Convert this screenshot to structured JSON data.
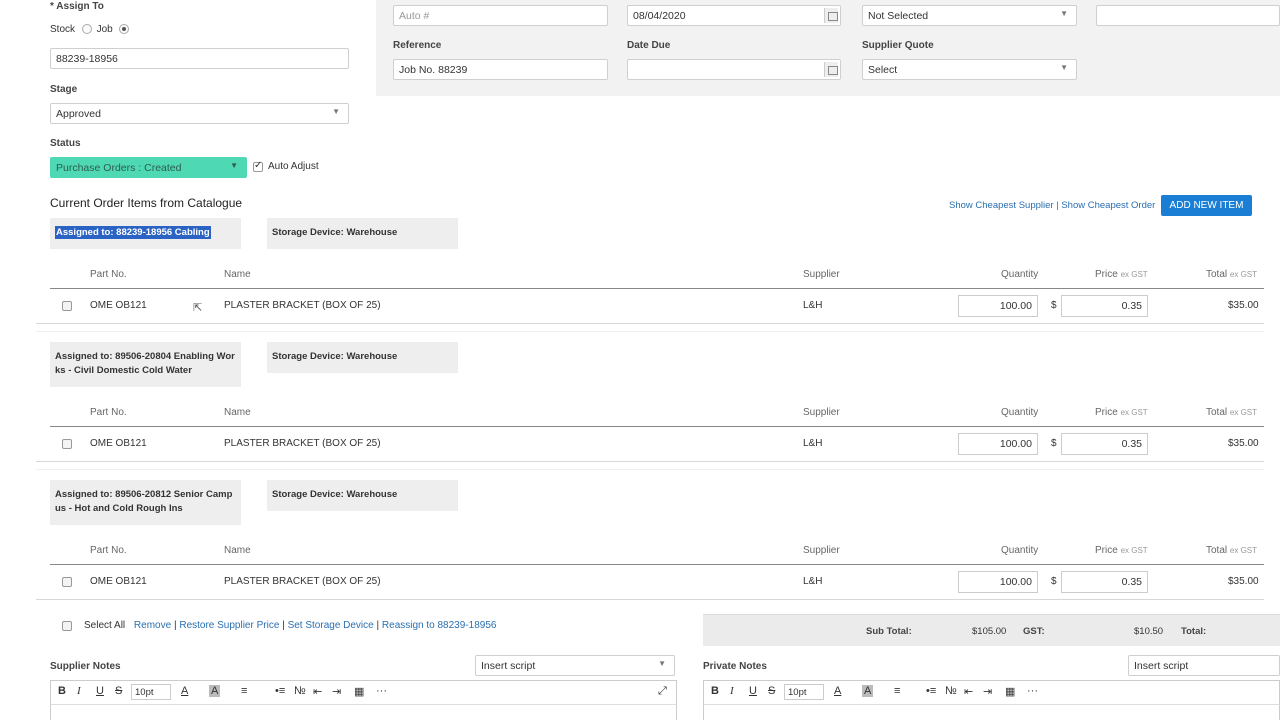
{
  "assign": {
    "label": "* Assign To",
    "opt_stock": "Stock",
    "opt_job": "Job",
    "value": "88239-18956"
  },
  "stage": {
    "label": "Stage",
    "value": "Approved"
  },
  "status": {
    "label": "Status",
    "value": "Purchase Orders : Created",
    "auto_adjust": "Auto Adjust",
    "color": "#4fd8b4"
  },
  "header": {
    "auto_placeholder": "Auto #",
    "date": "08/04/2020",
    "not_selected": "Not Selected",
    "reference_label": "Reference",
    "reference_value": "Job No. 88239",
    "date_due_label": "Date Due",
    "supplier_quote_label": "Supplier Quote",
    "supplier_quote_value": "Select"
  },
  "items": {
    "title": "Current Order Items from Catalogue",
    "show_cheapest_supplier": "Show Cheapest Supplier",
    "separator": "|",
    "show_cheapest_order": "Show Cheapest Order",
    "add_new_item": "ADD NEW ITEM",
    "columns": {
      "part": "Part No.",
      "name": "Name",
      "supplier": "Supplier",
      "qty": "Quantity",
      "price": "Price",
      "total": "Total",
      "ex_gst": "ex GST"
    },
    "currency": "$",
    "groups": [
      {
        "assigned": "Assigned to: 88239-18956 Cabling",
        "storage": "Storage Device: Warehouse",
        "row": {
          "part": "OME OB121",
          "name": "PLASTER BRACKET (BOX OF 25)",
          "supplier": "L&H",
          "qty": "100.00",
          "price": "0.35",
          "total": "$35.00"
        }
      },
      {
        "assigned_1": "Assigned to: 89506-20804 Enabling Wor",
        "assigned_2": "ks - Civil Domestic Cold Water",
        "storage": "Storage Device: Warehouse",
        "row": {
          "part": "OME OB121",
          "name": "PLASTER BRACKET (BOX OF 25)",
          "supplier": "L&H",
          "qty": "100.00",
          "price": "0.35",
          "total": "$35.00"
        }
      },
      {
        "assigned_1": "Assigned to: 89506-20812 Senior Camp",
        "assigned_2": "us - Hot and Cold Rough Ins",
        "storage": "Storage Device: Warehouse",
        "row": {
          "part": "OME OB121",
          "name": "PLASTER BRACKET (BOX OF 25)",
          "supplier": "L&H",
          "qty": "100.00",
          "price": "0.35",
          "total": "$35.00"
        }
      }
    ]
  },
  "actions": {
    "select_all": "Select All",
    "remove": "Remove",
    "restore": "Restore Supplier Price",
    "set_storage": "Set Storage Device",
    "reassign": "Reassign to 88239-18956",
    "sep": "|"
  },
  "totals": {
    "sub_label": "Sub Total:",
    "sub_value": "$105.00",
    "gst_label": "GST:",
    "gst_value": "$10.50",
    "total_label": "Total:"
  },
  "notes": {
    "supplier_label": "Supplier Notes",
    "private_label": "Private Notes",
    "insert_script": "Insert script",
    "font_size": "10pt",
    "more": "···"
  }
}
